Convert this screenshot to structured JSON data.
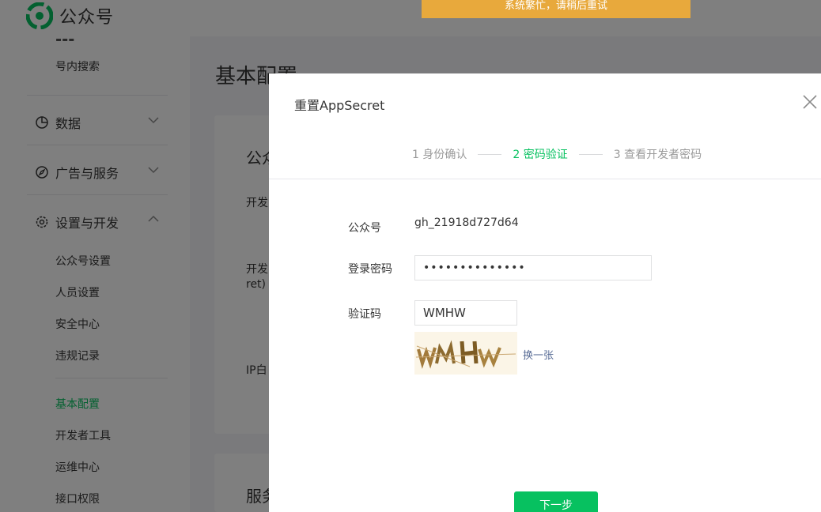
{
  "header": {
    "app_title": "公众号"
  },
  "sidebar": {
    "top_item": "号内搜索",
    "groups": [
      {
        "label": "数据",
        "icon": "chart-pie-icon",
        "chevron": "chevron-down-icon"
      },
      {
        "label": "广告与服务",
        "icon": "compass-icon",
        "chevron": "chevron-down-icon"
      },
      {
        "label": "设置与开发",
        "icon": "gear-icon",
        "chevron": "chevron-up-icon"
      }
    ],
    "settings_items": [
      "公众号设置",
      "人员设置",
      "安全中心",
      "违规记录"
    ],
    "dev_items": [
      "基本配置",
      "开发者工具",
      "运维中心",
      "接口权限"
    ],
    "active_item": "基本配置"
  },
  "main": {
    "title": "基本配置",
    "card1_peek": [
      "公众",
      "开发",
      "开发",
      "ret)",
      "IP白"
    ],
    "card2_peek": "服务"
  },
  "toast": {
    "text": "系统繁忙，请稍后重试"
  },
  "dialog": {
    "title": "重置AppSecret",
    "steps": [
      "1 身份确认",
      "2 密码验证",
      "3 查看开发者密码"
    ],
    "active_step": 1,
    "account_label": "公众号",
    "account_value": "gh_21918d727d64",
    "password_label": "登录密码",
    "password_value": "••••••••••••••",
    "captcha_label": "验证码",
    "captcha_value": "WMHW",
    "change_link": "换一张",
    "next_button": "下一步"
  },
  "colors": {
    "accent": "#07c160",
    "toast": "#e8a93c",
    "link": "#576b95",
    "overlay": "rgba(0,0,0,0.5)"
  }
}
